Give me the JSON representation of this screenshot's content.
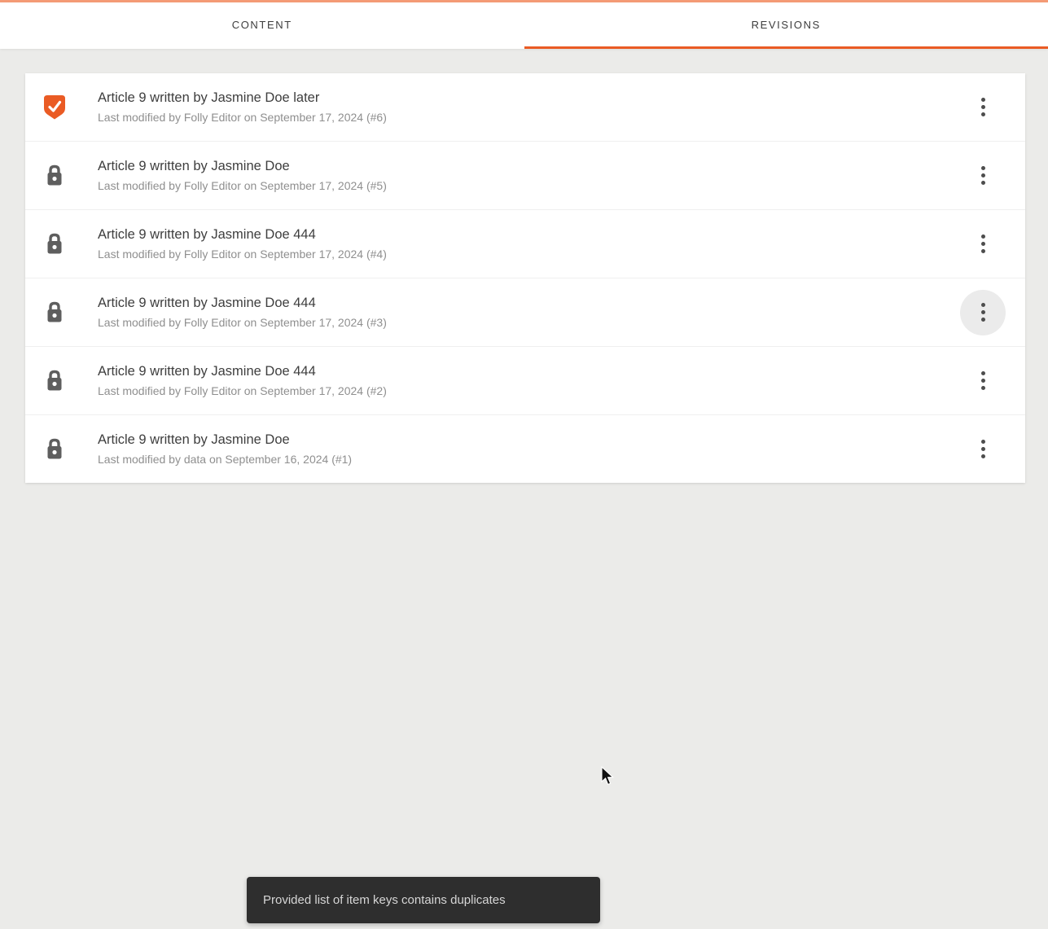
{
  "colors": {
    "accent": "#EA5B24",
    "top_line": "#F49B76",
    "page_background": "#EBEBE9",
    "toast_background": "#2E2E2E"
  },
  "tabs": [
    {
      "label": "CONTENT",
      "active": false
    },
    {
      "label": "REVISIONS",
      "active": true
    }
  ],
  "revisions": [
    {
      "title": "Article 9 written by Jasmine Doe later",
      "subtitle": "Last modified by Folly Editor on September 17, 2024 (#6)",
      "icon": "shield-check-badge",
      "selected": true,
      "menu_highlighted": false
    },
    {
      "title": "Article 9 written by Jasmine Doe",
      "subtitle": "Last modified by Folly Editor on September 17, 2024 (#5)",
      "icon": "lock",
      "selected": false,
      "menu_highlighted": false
    },
    {
      "title": "Article 9 written by Jasmine Doe 444",
      "subtitle": "Last modified by Folly Editor on September 17, 2024 (#4)",
      "icon": "lock",
      "selected": false,
      "menu_highlighted": false
    },
    {
      "title": "Article 9 written by Jasmine Doe 444",
      "subtitle": "Last modified by Folly Editor on September 17, 2024 (#3)",
      "icon": "lock",
      "selected": false,
      "menu_highlighted": true
    },
    {
      "title": "Article 9 written by Jasmine Doe 444",
      "subtitle": "Last modified by Folly Editor on September 17, 2024 (#2)",
      "icon": "lock",
      "selected": false,
      "menu_highlighted": false
    },
    {
      "title": "Article 9 written by Jasmine Doe",
      "subtitle": "Last modified by data on September 16, 2024 (#1)",
      "icon": "lock",
      "selected": false,
      "menu_highlighted": false
    }
  ],
  "toast": {
    "message": "Provided list of item keys contains duplicates"
  }
}
